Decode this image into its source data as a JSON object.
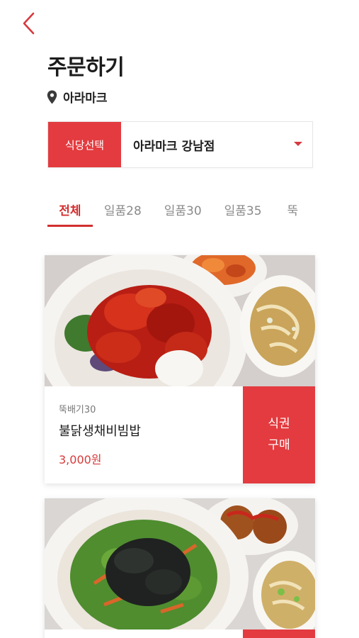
{
  "header": {
    "title": "주문하기",
    "location": "아라마크"
  },
  "store": {
    "label": "식당선택",
    "selected": "아라마크 강남점"
  },
  "tabs": [
    {
      "label": "전체",
      "active": true
    },
    {
      "label": "일품28",
      "active": false
    },
    {
      "label": "일품30",
      "active": false
    },
    {
      "label": "일품35",
      "active": false
    },
    {
      "label": "뚝",
      "active": false
    }
  ],
  "menu": [
    {
      "category": "뚝배기30",
      "name": "불닭생채비빔밥",
      "price": "3,000원",
      "buy_line1": "식권",
      "buy_line2": "구매",
      "image": "spicy-chicken-bibimbap-with-noodle-soup"
    },
    {
      "image": "seaweed-vegetable-bibimbap-with-croquette-and-noodle-soup"
    }
  ],
  "colors": {
    "accent": "#e33b3f",
    "tab_active": "#d32f2f",
    "price": "#d83a3a"
  },
  "icons": {
    "back": "chevron-left-icon",
    "location": "map-pin-icon",
    "dropdown": "caret-down-icon"
  }
}
